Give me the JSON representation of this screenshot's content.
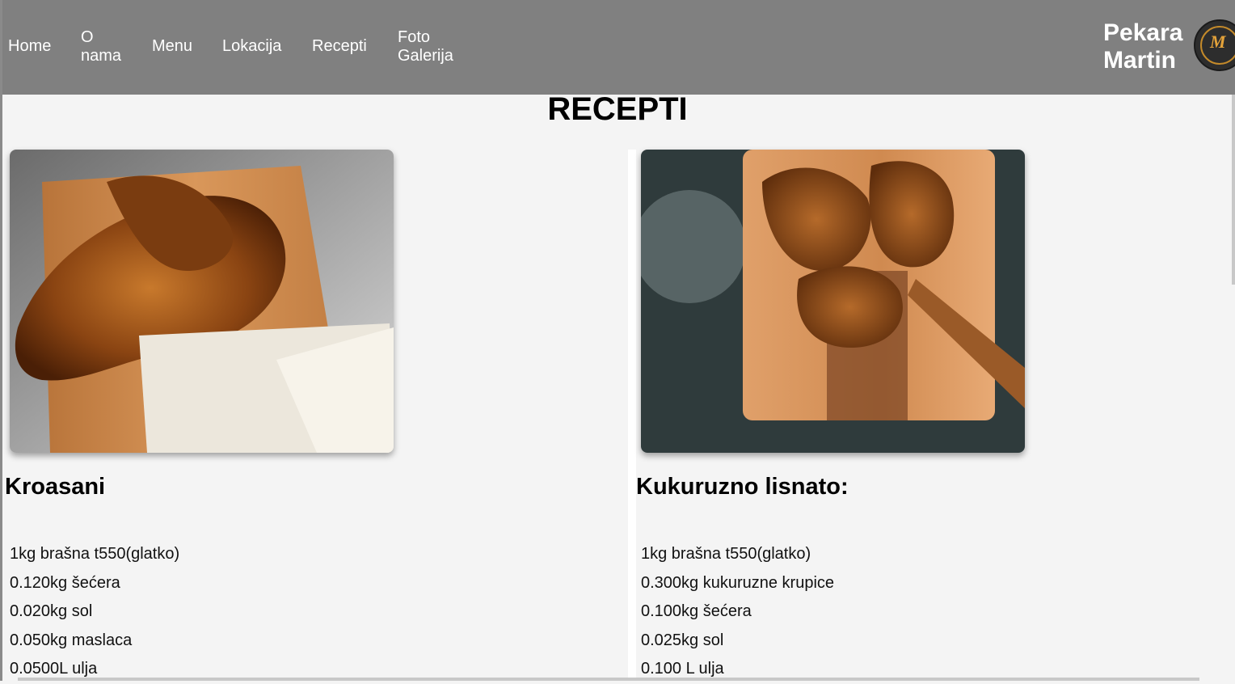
{
  "nav": {
    "items": [
      {
        "label": "Home"
      },
      {
        "label": "O\nnama"
      },
      {
        "label": "Menu"
      },
      {
        "label": "Lokacija"
      },
      {
        "label": "Recepti"
      },
      {
        "label": "Foto\nGalerija"
      }
    ]
  },
  "brand": {
    "name": "Pekara\nMartin",
    "logo_letter": "M",
    "logo_icon": "bakery-logo-icon"
  },
  "page": {
    "title": "RECEPTI"
  },
  "recipes": [
    {
      "title": "Kroasani",
      "image": "croissant-photo",
      "ingredients": [
        "1kg brašna t550(glatko)",
        "0.120kg šećera",
        "0.020kg sol",
        "0.050kg maslaca",
        "0.0500L ulja"
      ]
    },
    {
      "title": "Kukuruzno lisnato:",
      "image": "pastry-on-board-photo",
      "ingredients": [
        "1kg brašna t550(glatko)",
        "0.300kg kukuruzne krupice",
        "0.100kg šećera",
        "0.025kg sol",
        "0.100 L ulja"
      ]
    }
  ],
  "colors": {
    "header_bg": "#808080",
    "page_bg": "#f4f4f4",
    "text": "#000000"
  }
}
